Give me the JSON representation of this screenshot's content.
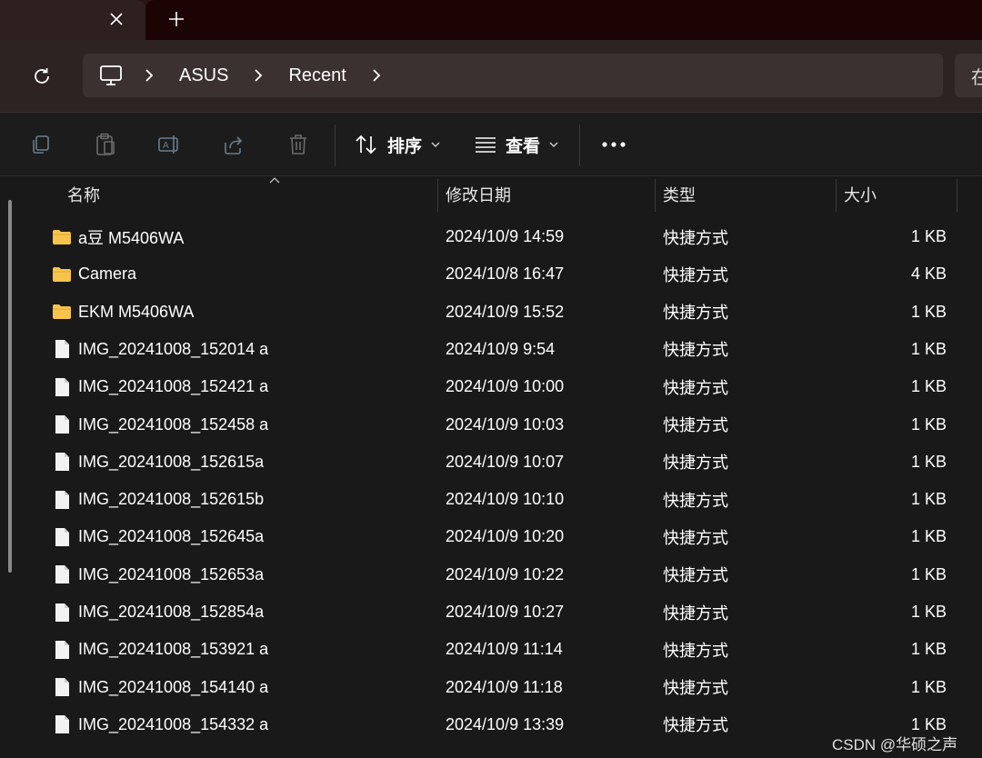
{
  "window": {
    "tab_close_icon": "close-icon",
    "new_tab_icon": "plus-icon"
  },
  "address_bar": {
    "breadcrumbs": [
      "ASUS",
      "Recent"
    ],
    "search_placeholder": "在"
  },
  "command_bar": {
    "sort_label": "排序",
    "view_label": "查看"
  },
  "list": {
    "columns": {
      "name": "名称",
      "date": "修改日期",
      "type": "类型",
      "size": "大小"
    },
    "items": [
      {
        "name": "a豆 M5406WA",
        "date": "2024/10/9 14:59",
        "type": "快捷方式",
        "size": "1 KB",
        "icon": "folder-icon"
      },
      {
        "name": "Camera",
        "date": "2024/10/8 16:47",
        "type": "快捷方式",
        "size": "4 KB",
        "icon": "folder-icon"
      },
      {
        "name": "EKM M5406WA",
        "date": "2024/10/9 15:52",
        "type": "快捷方式",
        "size": "1 KB",
        "icon": "folder-icon"
      },
      {
        "name": "IMG_20241008_152014 a",
        "date": "2024/10/9 9:54",
        "type": "快捷方式",
        "size": "1 KB",
        "icon": "file-icon"
      },
      {
        "name": "IMG_20241008_152421 a",
        "date": "2024/10/9 10:00",
        "type": "快捷方式",
        "size": "1 KB",
        "icon": "file-icon"
      },
      {
        "name": "IMG_20241008_152458 a",
        "date": "2024/10/9 10:03",
        "type": "快捷方式",
        "size": "1 KB",
        "icon": "file-icon"
      },
      {
        "name": "IMG_20241008_152615a",
        "date": "2024/10/9 10:07",
        "type": "快捷方式",
        "size": "1 KB",
        "icon": "file-icon"
      },
      {
        "name": "IMG_20241008_152615b",
        "date": "2024/10/9 10:10",
        "type": "快捷方式",
        "size": "1 KB",
        "icon": "file-icon"
      },
      {
        "name": "IMG_20241008_152645a",
        "date": "2024/10/9 10:20",
        "type": "快捷方式",
        "size": "1 KB",
        "icon": "file-icon"
      },
      {
        "name": "IMG_20241008_152653a",
        "date": "2024/10/9 10:22",
        "type": "快捷方式",
        "size": "1 KB",
        "icon": "file-icon"
      },
      {
        "name": "IMG_20241008_152854a",
        "date": "2024/10/9 10:27",
        "type": "快捷方式",
        "size": "1 KB",
        "icon": "file-icon"
      },
      {
        "name": "IMG_20241008_153921 a",
        "date": "2024/10/9 11:14",
        "type": "快捷方式",
        "size": "1 KB",
        "icon": "file-icon"
      },
      {
        "name": "IMG_20241008_154140 a",
        "date": "2024/10/9 11:18",
        "type": "快捷方式",
        "size": "1 KB",
        "icon": "file-icon"
      },
      {
        "name": "IMG_20241008_154332 a",
        "date": "2024/10/9 13:39",
        "type": "快捷方式",
        "size": "1 KB",
        "icon": "file-icon"
      }
    ]
  },
  "watermark": "CSDN @华硕之声",
  "colors": {
    "folder": "#f6c34c",
    "file": "#f2f2f2",
    "background": "#191919"
  }
}
